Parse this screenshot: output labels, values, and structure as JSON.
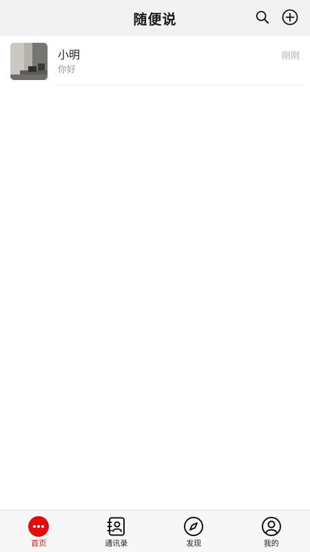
{
  "header": {
    "title": "随便说",
    "actions": [
      {
        "icon": "search-icon"
      },
      {
        "icon": "add-circle-icon"
      }
    ]
  },
  "conversations": [
    {
      "name": "小明",
      "preview": "你好",
      "time": "刚刚",
      "avatar_icon": "avatar-photo"
    }
  ],
  "tabs": [
    {
      "label": "首页",
      "icon": "chat-bubble-icon",
      "active": true
    },
    {
      "label": "通讯录",
      "icon": "contacts-icon",
      "active": false
    },
    {
      "label": "发现",
      "icon": "compass-icon",
      "active": false
    },
    {
      "label": "我的",
      "icon": "profile-icon",
      "active": false
    }
  ],
  "colors": {
    "accent": "#e30d0d",
    "header_bg": "#f2f2f2",
    "tabbar_bg": "#f7f7f7"
  }
}
